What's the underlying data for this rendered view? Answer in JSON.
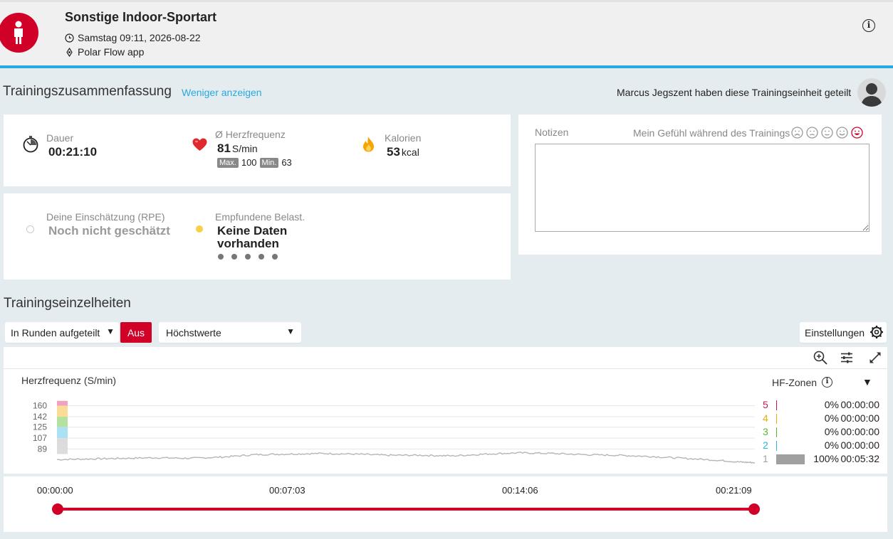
{
  "header": {
    "title": "Sonstige Indoor-Sportart",
    "datetime": "Samstag 09:11, 2026-08-22",
    "source": "Polar Flow app",
    "info_icon": "i"
  },
  "summary": {
    "title": "Trainingszusammenfassung",
    "less_link": "Weniger anzeigen",
    "shared_text": "Marcus Jegszent haben diese Trainingseinheit geteilt",
    "duration": {
      "label": "Dauer",
      "value": "00:21:10",
      "icon": "stopwatch-icon"
    },
    "heart_rate": {
      "label": "Ø Herzfrequenz",
      "value": "81",
      "unit": "S/min",
      "max_tag": "Max.",
      "max_value": "100",
      "min_tag": "Min.",
      "min_value": "63",
      "icon": "heart-icon"
    },
    "calories": {
      "label": "Kalorien",
      "value": "53",
      "unit": "kcal",
      "icon": "flame-icon"
    },
    "rpe": {
      "label": "Deine Einschätzung (RPE)",
      "value": "Noch nicht geschätzt"
    },
    "perceived_load": {
      "label": "Empfundene Belast.",
      "value_line1": "Keine Daten",
      "value_line2": "vorhanden",
      "dots": 5
    }
  },
  "notes": {
    "label": "Notizen",
    "feeling_label": "Mein Gefühl während des Trainings",
    "value": ""
  },
  "details": {
    "title": "Trainingseinzelheiten",
    "laps_select": "In Runden aufgeteilt",
    "aus_button": "Aus",
    "metric_select": "Höchstwerte",
    "settings_button": "Einstellungen"
  },
  "chart_data": {
    "type": "line",
    "title": "Herzfrequenz (S/min)",
    "ylabel": "Herzfrequenz (S/min)",
    "yticks": [
      "160",
      "142",
      "125",
      "107",
      "89"
    ],
    "ylim": [
      63,
      170
    ],
    "xlim": [
      0,
      1269
    ],
    "series": [
      {
        "x": [
          0,
          60,
          120,
          180,
          240,
          300,
          360,
          420,
          480,
          540,
          600,
          660,
          720,
          780,
          840,
          900,
          960,
          1020,
          1080,
          1140,
          1200,
          1240,
          1269
        ],
        "values": [
          72,
          73,
          74,
          75,
          74,
          76,
          80,
          81,
          82,
          81,
          79,
          79,
          78,
          81,
          83,
          82,
          80,
          79,
          77,
          74,
          71,
          68,
          67
        ]
      }
    ],
    "zones_title": "HF-Zonen",
    "zones": [
      {
        "zone": "5",
        "percent": "0%",
        "time": "00:00:00",
        "color": "#c2185b",
        "fraction": 0
      },
      {
        "zone": "4",
        "percent": "0%",
        "time": "00:00:00",
        "color": "#e8b000",
        "fraction": 0
      },
      {
        "zone": "3",
        "percent": "0%",
        "time": "00:00:00",
        "color": "#5cb531",
        "fraction": 0
      },
      {
        "zone": "2",
        "percent": "0%",
        "time": "00:00:00",
        "color": "#2bb6e0",
        "fraction": 0
      },
      {
        "zone": "1",
        "percent": "100%",
        "time": "00:05:32",
        "color": "#a0a0a0",
        "fraction": 1
      }
    ]
  },
  "timeline": {
    "labels": [
      "00:00:00",
      "00:07:03",
      "00:14:06",
      "00:21:09"
    ],
    "range": [
      0,
      1
    ]
  },
  "colors": {
    "accent_red": "#d10027",
    "accent_blue": "#27a9e1",
    "zone_5": "#f0a0c0",
    "zone_4": "#fadc96",
    "zone_3": "#b4e1a0",
    "zone_2": "#aae1f5",
    "zone_1": "#dcdcdc"
  }
}
